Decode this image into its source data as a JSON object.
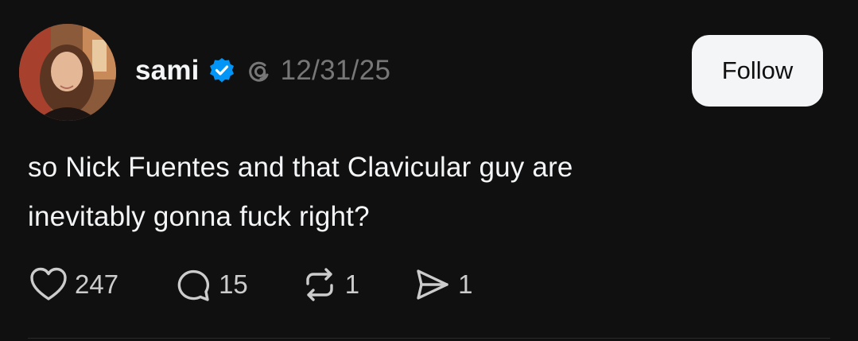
{
  "author": {
    "username": "sami",
    "verified": true,
    "timestamp": "12/31/25"
  },
  "follow_button": {
    "label": "Follow"
  },
  "post": {
    "text_lines": [
      "so Nick Fuentes and that Clavicular guy are",
      "inevitably gonna fuck right?"
    ]
  },
  "actions": {
    "likes": "247",
    "replies": "15",
    "reposts": "1",
    "shares": "1"
  },
  "colors": {
    "background": "#101010",
    "text": "#f3f5f7",
    "muted": "#777777",
    "verified_blue": "#0095f6"
  },
  "icons": {
    "verified": "verified-badge-icon",
    "threads": "threads-logo-icon",
    "like": "heart-icon",
    "reply": "comment-bubble-icon",
    "repost": "repost-icon",
    "share": "send-icon"
  }
}
